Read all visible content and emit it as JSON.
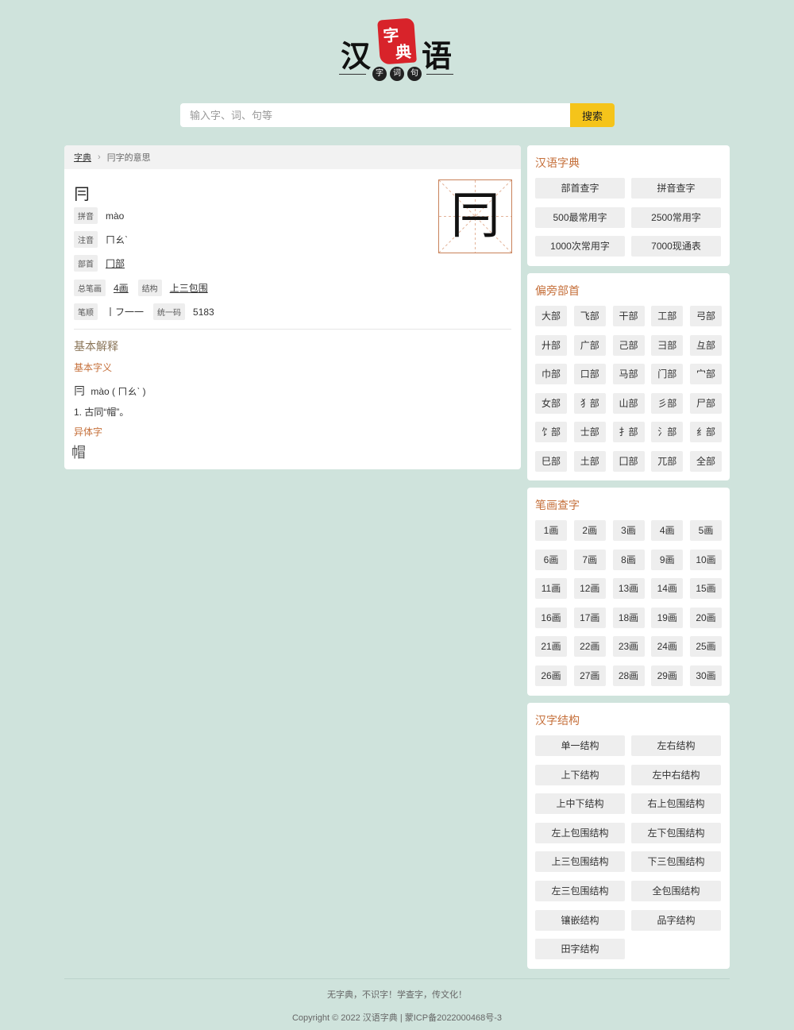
{
  "logo": {
    "left_char": "汉",
    "right_char": "语",
    "seal_chars": [
      "字",
      "典"
    ],
    "sub_chars": [
      "字",
      "词",
      "句"
    ],
    "seal_color": "#d8232a"
  },
  "search": {
    "placeholder": "输入字、词、句等",
    "button_label": "搜索",
    "button_color": "#f5c41a"
  },
  "breadcrumb": {
    "home": "字典",
    "current": "冃字的意思"
  },
  "character": {
    "char": "冃",
    "pinyin_label": "拼音",
    "pinyin": "mào",
    "zhuyin_label": "注音",
    "zhuyin": "ㄇㄠˋ",
    "radical_label": "部首",
    "radical": "冂部",
    "strokes_label": "总笔画",
    "strokes": "4画",
    "structure_label": "结构",
    "structure": "上三包围",
    "order_label": "笔顺",
    "order": "丨フ一一",
    "unicode_label": "统一码",
    "unicode": "5183"
  },
  "explanation": {
    "heading": "基本解释",
    "basic_meaning": "基本字义",
    "headword_char": "冃",
    "headword_pron": "mào ( ㄇㄠˋ )",
    "definition": "1.  古同“帽”。",
    "variant_heading": "异体字",
    "variant_char": "帽"
  },
  "panel_dictionary": {
    "title": "汉语字典",
    "items": [
      "部首查字",
      "拼音查字",
      "500最常用字",
      "2500常用字",
      "1000次常用字",
      "7000现通表"
    ]
  },
  "panel_radicals": {
    "title": "偏旁部首",
    "items": [
      "大部",
      "飞部",
      "干部",
      "工部",
      "弓部",
      "廾部",
      "广部",
      "己部",
      "彐部",
      "彑部",
      "巾部",
      "口部",
      "马部",
      "门部",
      "宀部",
      "女部",
      "犭部",
      "山部",
      "彡部",
      "尸部",
      "饣部",
      "士部",
      "扌部",
      "氵部",
      "纟部",
      "巳部",
      "土部",
      "囗部",
      "兀部",
      "全部"
    ]
  },
  "panel_strokes": {
    "title": "笔画查字",
    "items": [
      "1画",
      "2画",
      "3画",
      "4画",
      "5画",
      "6画",
      "7画",
      "8画",
      "9画",
      "10画",
      "11画",
      "12画",
      "13画",
      "14画",
      "15画",
      "16画",
      "17画",
      "18画",
      "19画",
      "20画",
      "21画",
      "22画",
      "23画",
      "24画",
      "25画",
      "26画",
      "27画",
      "28画",
      "29画",
      "30画"
    ]
  },
  "panel_structures": {
    "title": "汉字结构",
    "items": [
      "单一结构",
      "左右结构",
      "上下结构",
      "左中右结构",
      "上中下结构",
      "右上包围结构",
      "左上包围结构",
      "左下包围结构",
      "上三包围结构",
      "下三包围结构",
      "左三包围结构",
      "全包围结构",
      "镶嵌结构",
      "品字结构",
      "田字结构"
    ]
  },
  "footer": {
    "slogan": "无字典，不识字！学查字，传文化！",
    "copyright": "Copyright © 2022 汉语字典 | 蒙ICP备2022000468号-3"
  },
  "colors": {
    "background": "#cfe3dc",
    "accent": "#c56f3a"
  }
}
